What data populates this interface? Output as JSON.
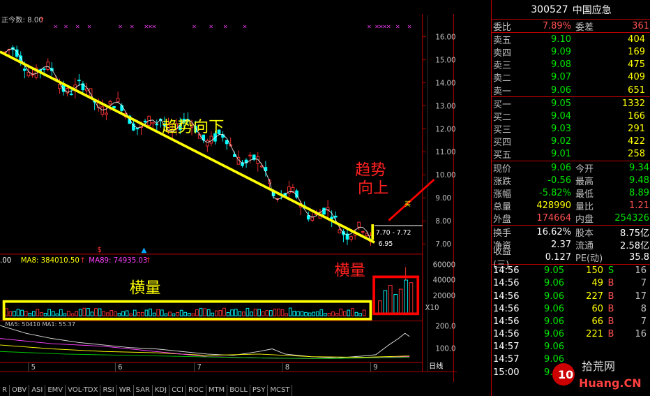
{
  "chart": {
    "top_label": "正今数: 8.00",
    "price_ticks": [
      "16.00",
      "15.00",
      "14.00",
      "13.00",
      "12.00",
      "11.00",
      "10.00",
      "9.00",
      "8.00",
      "7.00"
    ],
    "volume_ticks": [
      "60000",
      "40000",
      "20000",
      "X10"
    ],
    "indicator_ticks": [
      "200.0",
      "100.0"
    ],
    "ma_line": {
      "a": ".00",
      "b": "MA8: 384010.50",
      "c": "MA89: 74935.03"
    },
    "ma_line2": "MA5: 50410   MA1: 55.37",
    "annotation_down": "趋势向下",
    "annotation_up_1": "趋势",
    "annotation_up_2": "向上",
    "annotation_flat_left": "横量",
    "annotation_flat_right": "横量",
    "annotation_buy": "买",
    "price_range": "7.70 - 7.72",
    "low_price": "6.95",
    "month_ticks": [
      "5",
      "6",
      "7",
      "8",
      "9"
    ],
    "period": "日线",
    "colors": {
      "up": "#ff3232",
      "down": "#00ffff",
      "trend": "#ffff00",
      "trend_up": "#ff0000"
    }
  },
  "toolbar": [
    "R",
    "OBV",
    "ASI",
    "EMV",
    "VOL-TDX",
    "RSI",
    "WR",
    "SAR",
    "KDJ",
    "CCI",
    "ROC",
    "MTM",
    "BOLL",
    "PSY",
    "MCST"
  ],
  "quote": {
    "code": "300527",
    "name": "中国应急",
    "wb": {
      "label": "委比",
      "value": "7.89%",
      "label2": "委差",
      "value2": "361"
    },
    "asks": [
      {
        "label": "卖五",
        "price": "9.10",
        "vol": "404"
      },
      {
        "label": "卖四",
        "price": "9.09",
        "vol": "169"
      },
      {
        "label": "卖三",
        "price": "9.08",
        "vol": "475"
      },
      {
        "label": "卖二",
        "price": "9.07",
        "vol": "409"
      },
      {
        "label": "卖一",
        "price": "9.06",
        "vol": "651"
      }
    ],
    "bids": [
      {
        "label": "买一",
        "price": "9.05",
        "vol": "1332"
      },
      {
        "label": "买二",
        "price": "9.04",
        "vol": "166"
      },
      {
        "label": "买三",
        "price": "9.03",
        "vol": "291"
      },
      {
        "label": "买四",
        "price": "9.02",
        "vol": "422"
      },
      {
        "label": "买五",
        "price": "9.01",
        "vol": "258"
      }
    ],
    "stats1": [
      {
        "l1": "现价",
        "v1": "9.06",
        "c1": "green",
        "l2": "今开",
        "v2": "9.34",
        "c2": "green"
      },
      {
        "l1": "涨跌",
        "v1": "-0.56",
        "c1": "green",
        "l2": "最高",
        "v2": "9.48",
        "c2": "green"
      },
      {
        "l1": "涨幅",
        "v1": "-5.82%",
        "c1": "green",
        "l2": "最低",
        "v2": "8.89",
        "c2": "green"
      },
      {
        "l1": "总量",
        "v1": "428990",
        "c1": "yellow",
        "l2": "量比",
        "v2": "1.21",
        "c2": "red"
      },
      {
        "l1": "外盘",
        "v1": "174664",
        "c1": "red",
        "l2": "内盘",
        "v2": "254326",
        "c2": "green"
      }
    ],
    "stats2": [
      {
        "l1": "换手",
        "v1": "16.62%",
        "c1": "white",
        "l2": "股本",
        "v2": "8.75亿",
        "c2": "white"
      },
      {
        "l1": "净资",
        "v1": "2.37",
        "c1": "white",
        "l2": "流通",
        "v2": "2.58亿",
        "c2": "white"
      },
      {
        "l1": "收益(三)",
        "v1": "0.127",
        "c1": "white",
        "l2": "PE(动)",
        "v2": "35.8",
        "c2": "white"
      }
    ],
    "ticks": [
      {
        "t": "14:56",
        "p": "9.05",
        "v": "150",
        "bs": "S",
        "n": "16"
      },
      {
        "t": "14:56",
        "p": "9.06",
        "v": "49",
        "bs": "B",
        "n": "7"
      },
      {
        "t": "14:56",
        "p": "9.06",
        "v": "227",
        "bs": "B",
        "n": "17"
      },
      {
        "t": "14:56",
        "p": "9.06",
        "v": "60",
        "bs": "B",
        "n": "8"
      },
      {
        "t": "14:56",
        "p": "9.06",
        "v": "66",
        "bs": "B",
        "n": "7"
      },
      {
        "t": "14:56",
        "p": "9.06",
        "v": "221",
        "bs": "B",
        "n": "16"
      },
      {
        "t": "14:57",
        "p": "9.06",
        "v": "",
        "bs": "",
        "n": ""
      },
      {
        "t": "14:57",
        "p": "9.06",
        "v": "",
        "bs": "",
        "n": ""
      },
      {
        "t": "15:00",
        "p": "9.06",
        "v": "",
        "bs": "",
        "n": ""
      }
    ]
  },
  "watermark": {
    "line1": "拾荒网",
    "line2": "Huang.CN",
    "logo": "10"
  }
}
